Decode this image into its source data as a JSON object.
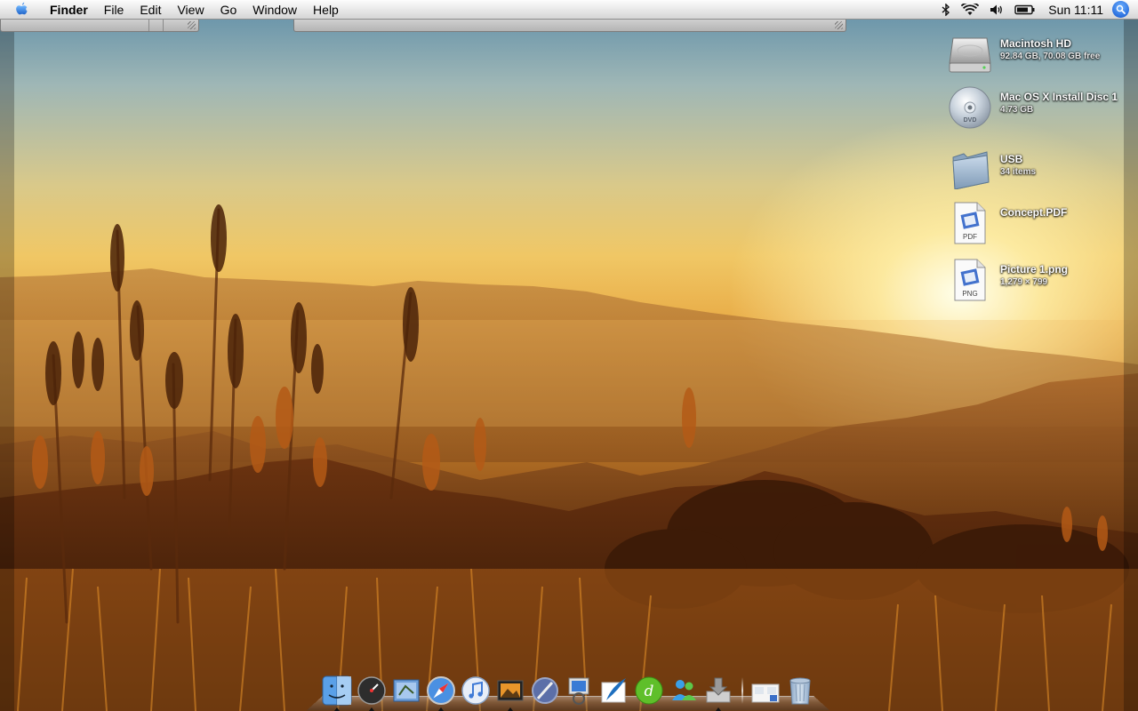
{
  "menubar": {
    "app_name": "Finder",
    "menus": [
      "File",
      "Edit",
      "View",
      "Go",
      "Window",
      "Help"
    ],
    "clock": "Sun 11:11",
    "status_icons": [
      "bluetooth-icon",
      "wifi-icon",
      "volume-icon",
      "battery-icon"
    ]
  },
  "desktop_items": [
    {
      "name": "Macintosh HD",
      "detail": "92.84 GB, 70.08 GB free",
      "icon": "hard-drive-icon"
    },
    {
      "name": "Mac OS X Install Disc 1",
      "detail": "4.73 GB",
      "icon": "dvd-icon"
    },
    {
      "name": "USB",
      "detail": "34 items",
      "icon": "folder-icon"
    },
    {
      "name": "Concept.PDF",
      "detail": "",
      "icon": "pdf-document-icon",
      "badge": "PDF"
    },
    {
      "name": "Picture 1.png",
      "detail": "1,279 × 799",
      "icon": "png-document-icon",
      "badge": "PNG"
    }
  ],
  "dock": {
    "items": [
      "finder-icon",
      "dashboard-icon",
      "mail-icon",
      "safari-icon",
      "itunes-icon",
      "iphoto-icon",
      "xcode-icon",
      "preview-icon",
      "quill-icon",
      "dreamweaver-icon",
      "messenger-icon",
      "downloads-icon",
      "documents-stack-icon",
      "trash-icon"
    ],
    "running": [
      "finder-icon",
      "dashboard-icon",
      "safari-icon",
      "iphoto-icon",
      "downloads-icon"
    ]
  },
  "colors": {
    "menubar": "#e9e9e9",
    "spotlight": "#2a6fde",
    "sky_top": "#5f8ea8",
    "sun_glow": "#fff6cf"
  }
}
